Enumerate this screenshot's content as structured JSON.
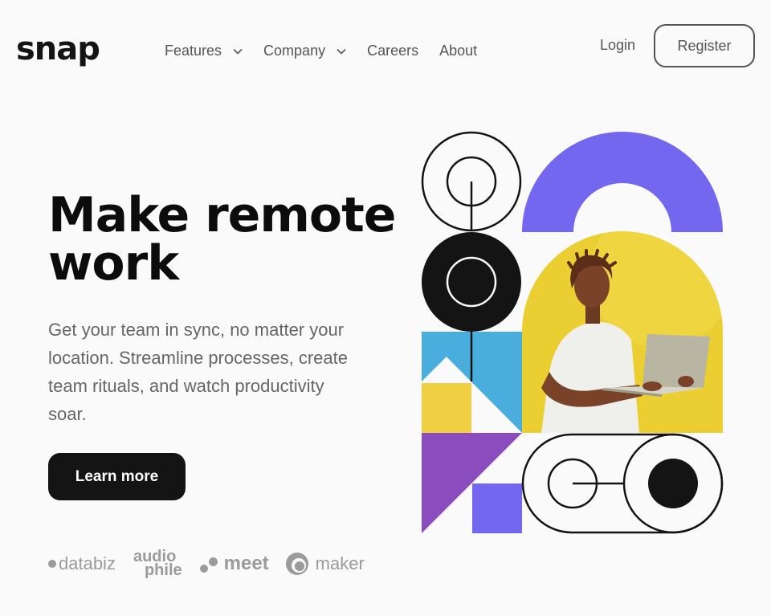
{
  "brand": {
    "name": "snap"
  },
  "nav": {
    "items": [
      {
        "label": "Features",
        "has_dropdown": true
      },
      {
        "label": "Company",
        "has_dropdown": true
      },
      {
        "label": "Careers",
        "has_dropdown": false
      },
      {
        "label": "About",
        "has_dropdown": false
      }
    ],
    "login_label": "Login",
    "register_label": "Register"
  },
  "hero": {
    "title_line1": "Make remote",
    "title_line2": "work",
    "description": "Get your team in sync, no matter your location. Streamline processes, create team rituals, and watch productivity soar.",
    "cta_label": "Learn more"
  },
  "clients": {
    "databiz": "databiz",
    "audiophile_line1": "audio",
    "audiophile_line2": "phile",
    "meet": "meet",
    "maker": "maker"
  },
  "colors": {
    "purple": "#7367f0",
    "yellow": "#f0cf42",
    "blue": "#49aedd",
    "violet": "#8b4cbd",
    "dark": "#141414"
  },
  "illustration": {
    "icon": "person-with-laptop-image"
  }
}
